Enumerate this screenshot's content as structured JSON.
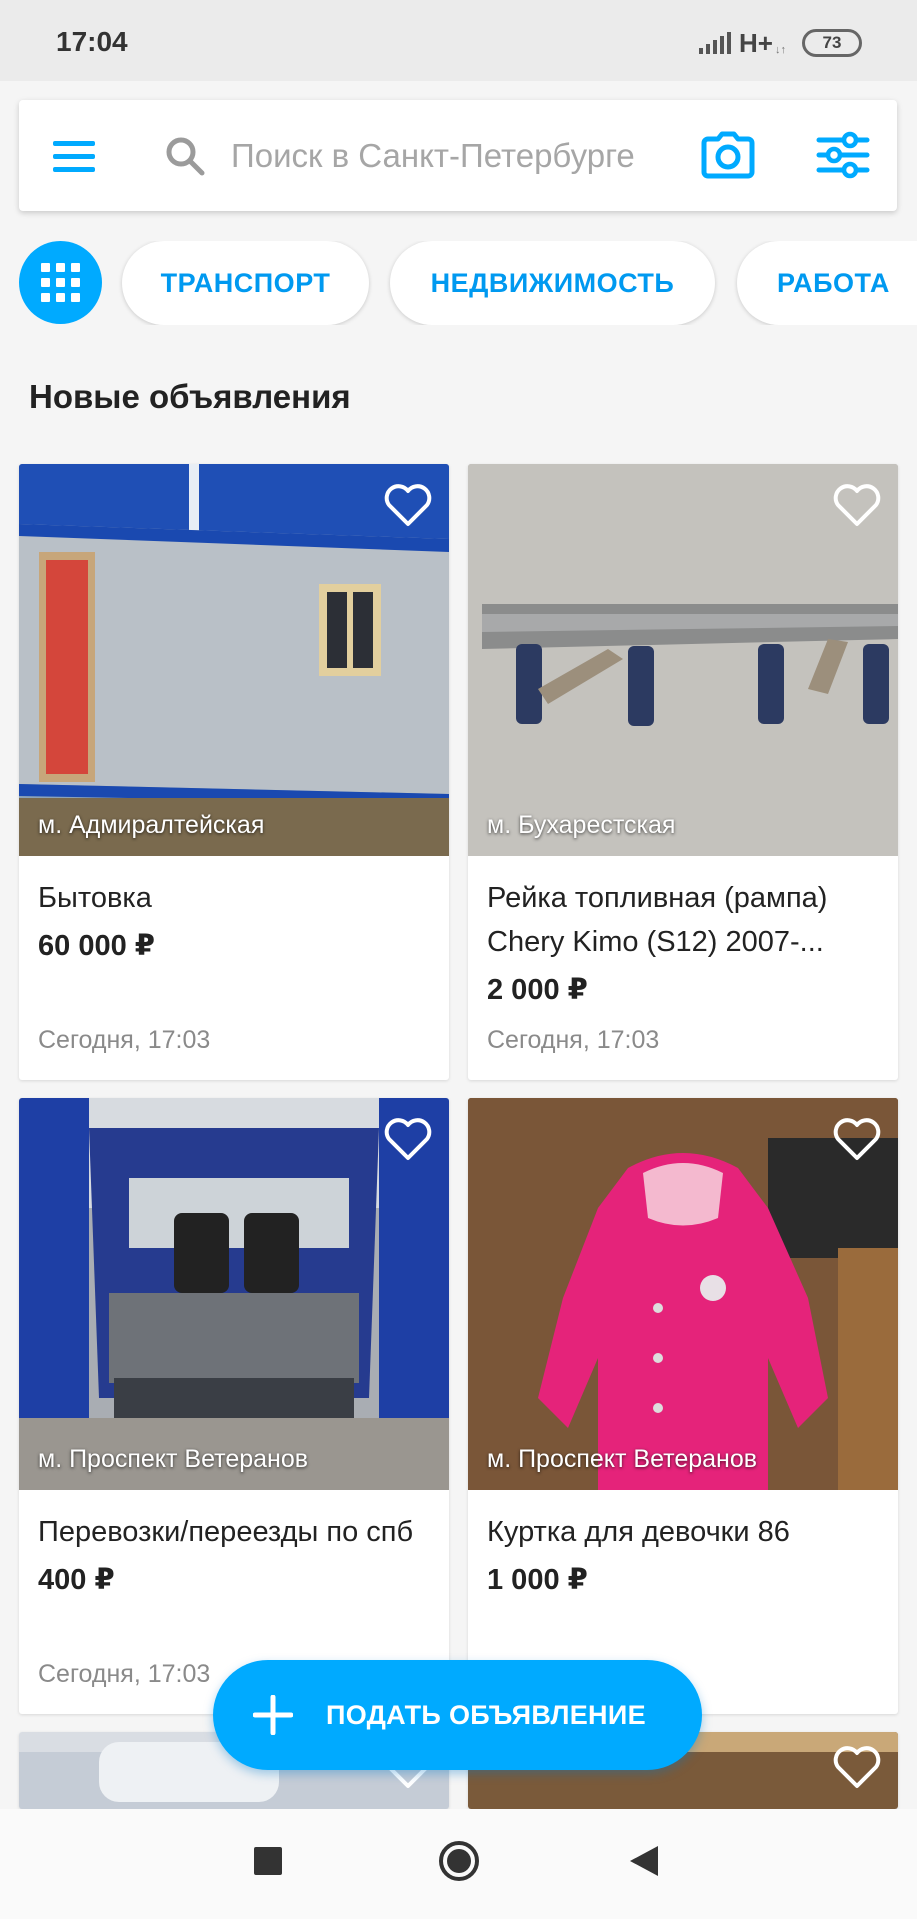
{
  "status_bar": {
    "time": "17:04",
    "network": "H+",
    "battery": "73"
  },
  "search": {
    "placeholder": "Поиск в Санкт-Петербурге"
  },
  "categories": [
    {
      "label": "ТРАНСПОРТ"
    },
    {
      "label": "НЕДВИЖИМОСТЬ"
    },
    {
      "label": "РАБОТА"
    }
  ],
  "section_title": "Новые объявления",
  "listings": [
    {
      "metro": "м. Адмиралтейская",
      "title": "Бытовка",
      "price": "60 000 ₽",
      "date": "Сегодня, 17:03"
    },
    {
      "metro": "м. Бухарестская",
      "title": "Рейка топливная (рампа) Chery Kimo (S12) 2007-...",
      "price": "2 000 ₽",
      "date": "Сегодня, 17:03"
    },
    {
      "metro": "м. Проспект Ветеранов",
      "title": "Перевозки/переезды по спб",
      "price": "400 ₽",
      "date": "Сегодня, 17:03"
    },
    {
      "metro": "м. Проспект Ветеранов",
      "title": "Куртка для девочки 86",
      "price": "1 000 ₽",
      "date": ""
    }
  ],
  "fab": {
    "label": "ПОДАТЬ ОБЪЯВЛЕНИЕ"
  },
  "colors": {
    "accent": "#00aaff",
    "chip_text": "#0099f0",
    "muted": "#8a8a8a"
  }
}
